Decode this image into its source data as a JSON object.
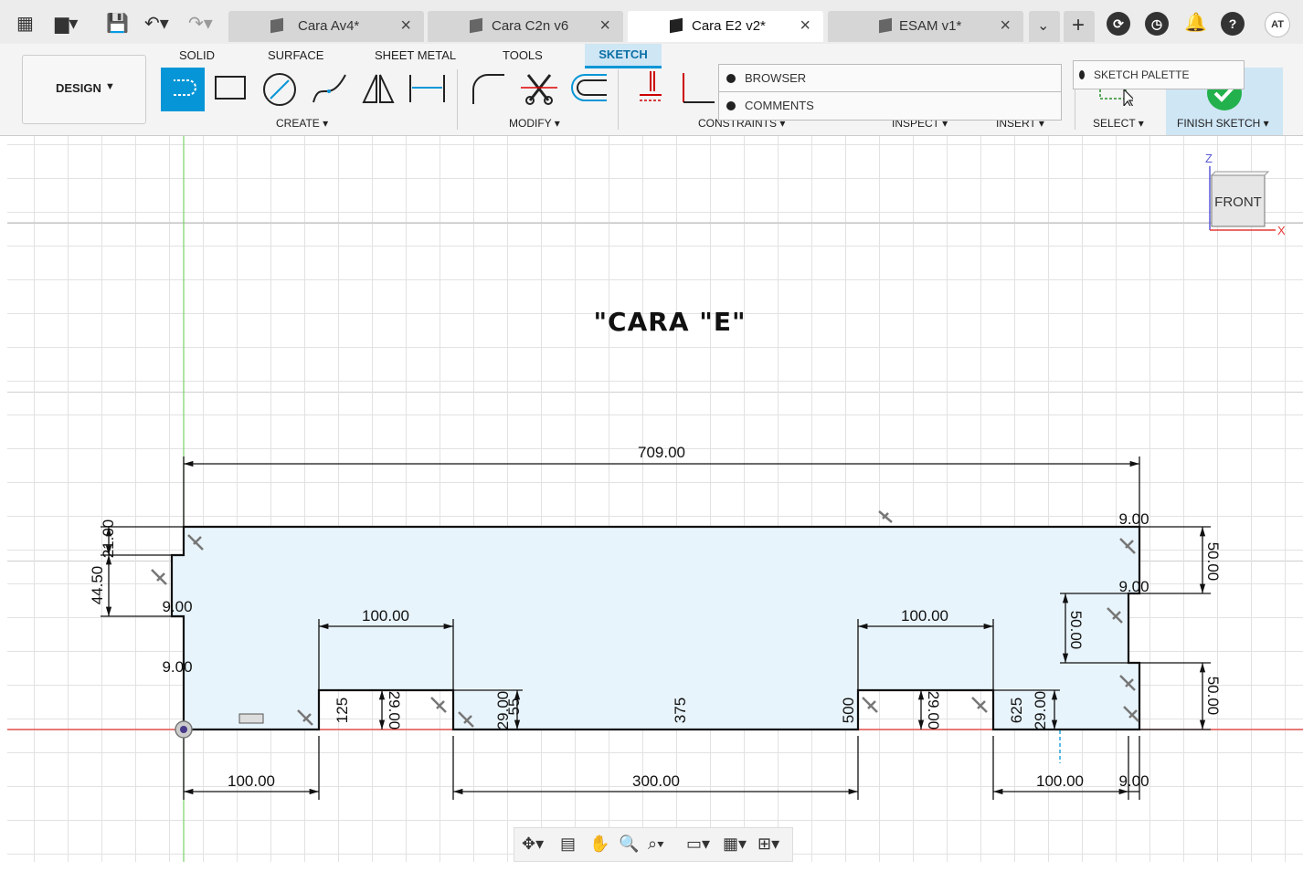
{
  "app": {
    "tabs": [
      {
        "label": "Cara Av4*"
      },
      {
        "label": "Cara C2n v6"
      },
      {
        "label": "Cara E2 v2*"
      },
      {
        "label": "ESAM v1*"
      }
    ],
    "user_initials": "AT"
  },
  "toolbar": {
    "design_label": "DESIGN",
    "workspace_tabs": [
      "SOLID",
      "SURFACE",
      "SHEET METAL",
      "TOOLS",
      "SKETCH"
    ],
    "active_tab": "SKETCH",
    "groups": {
      "create": "CREATE",
      "modify": "MODIFY",
      "constraints": "CONSTRAINTS",
      "inspect": "INSPECT",
      "insert": "INSERT",
      "select": "SELECT",
      "finish": "FINISH SKETCH"
    }
  },
  "panels": {
    "browser": "BROWSER",
    "comments": "COMMENTS",
    "sketch_palette": "SKETCH PALETTE"
  },
  "viewcube": {
    "face": "FRONT",
    "axis_z": "Z",
    "axis_x": "X"
  },
  "sketch": {
    "title_text": "\"CARA \"E\"",
    "dims": {
      "overall_width": "709.00",
      "top_right_notch": "9.00",
      "right_notch_2": "9.00",
      "right_top_height": "50.00",
      "right_mid_height": "50.00",
      "right_bottom_height": "50.00",
      "left_top": "21.00",
      "left_height": "44.50",
      "left_notch_w": "9.00",
      "left_notch_w2": "9.00",
      "slot1_width": "100.00",
      "slot2_width": "100.00",
      "slot_depth_1": "29.00",
      "slot_depth_2": "29.00",
      "slot_depth_3": "29.00",
      "slot_depth_4": "29.00",
      "small_125": "125",
      "small_55": "55",
      "small_375": "375",
      "small_500": "500",
      "small_625": "625",
      "bottom_left": "100.00",
      "bottom_mid": "300.00",
      "bottom_right": "100.00",
      "bottom_right_notch": "9.00"
    }
  },
  "colors": {
    "accent": "#0696d7",
    "profile_fill": "#e8f4fb",
    "x_axis": "#e53935",
    "z_axis": "#7ad36b",
    "finish_bg": "#cfe6f5",
    "finish_check": "#22b14c"
  }
}
